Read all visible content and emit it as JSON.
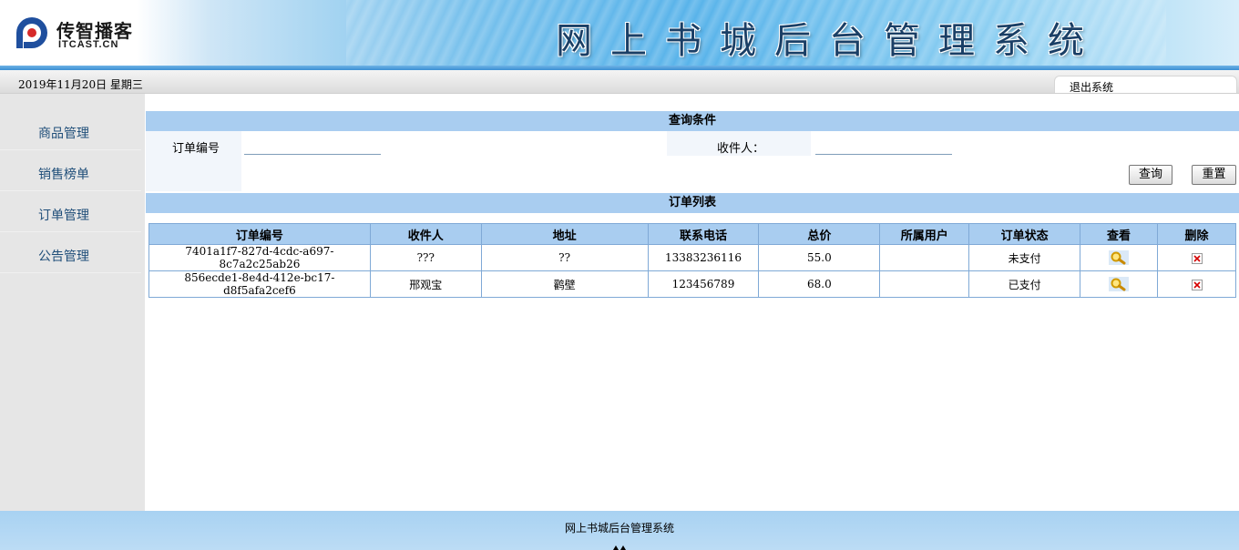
{
  "header": {
    "logo_name": "传智播客",
    "logo_sub": "ITCAST.CN",
    "system_title": "网上书城后台管理系统",
    "colors": {
      "header_gradient_mid": "#58b3ea",
      "title_text": "#1a3f66"
    }
  },
  "datebar": {
    "date": "2019年11月20日 星期三",
    "logout": "退出系统"
  },
  "sidebar": {
    "items": [
      {
        "label": "商品管理"
      },
      {
        "label": "销售榜单"
      },
      {
        "label": "订单管理"
      },
      {
        "label": "公告管理"
      }
    ]
  },
  "query": {
    "title": "查询条件",
    "order_id_label": "订单编号",
    "order_id_value": "",
    "receiver_label": "收件人：",
    "receiver_value": "",
    "search_button": "查询",
    "reset_button": "重置"
  },
  "orders": {
    "title": "订单列表",
    "columns": [
      "订单编号",
      "收件人",
      "地址",
      "联系电话",
      "总价",
      "所属用户",
      "订单状态",
      "查看",
      "删除"
    ],
    "rows": [
      {
        "id": "7401a1f7-827d-4cdc-a697-8c7a2c25ab26",
        "receiver": "???",
        "address": "??",
        "phone": "13383236116",
        "total": "55.0",
        "user": "",
        "status": "未支付"
      },
      {
        "id": "856ecde1-8e4d-412e-bc17-d8f5afa2cef6",
        "receiver": "邢观宝",
        "address": "鹳壁",
        "phone": "123456789",
        "total": "68.0",
        "user": "",
        "status": "已支付"
      }
    ],
    "view_icon": "magnifier-icon",
    "delete_icon": "delete-x-icon"
  },
  "footer": {
    "text": "网上书城后台管理系统"
  }
}
